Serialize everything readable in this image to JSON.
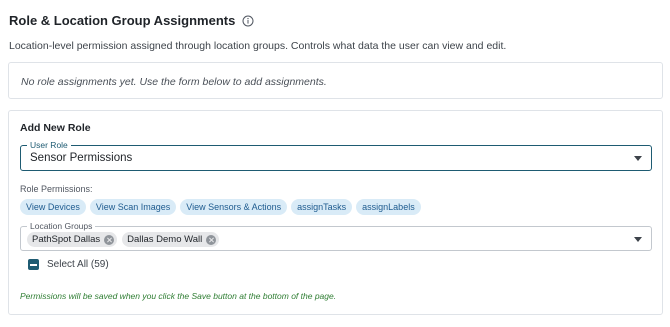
{
  "section": {
    "title": "Role & Location Group Assignments",
    "info_icon": "info-circle-icon",
    "description": "Location-level permission assigned through location groups. Controls what data the user can view and edit."
  },
  "assignments": {
    "empty_message": "No role assignments yet. Use the form below to add assignments."
  },
  "add_role": {
    "title": "Add New Role",
    "user_role": {
      "label": "User Role",
      "value": "Sensor Permissions"
    },
    "role_permissions": {
      "label": "Role Permissions:",
      "chips": [
        "View Devices",
        "View Scan Images",
        "View Sensors & Actions",
        "assignTasks",
        "assignLabels"
      ]
    },
    "location_groups": {
      "label": "Location Groups",
      "selected": [
        "PathSpot Dallas",
        "Dallas Demo Wall"
      ]
    },
    "select_all": {
      "label": "Select All (59)",
      "state": "indeterminate"
    },
    "save_note": "Permissions will be saved when you click the Save button at the bottom of the page."
  },
  "colors": {
    "accent": "#1e5b72",
    "chip_bg": "#d9ebf7",
    "chip_text": "#1e5b8f",
    "note_green": "#2e7d32"
  }
}
